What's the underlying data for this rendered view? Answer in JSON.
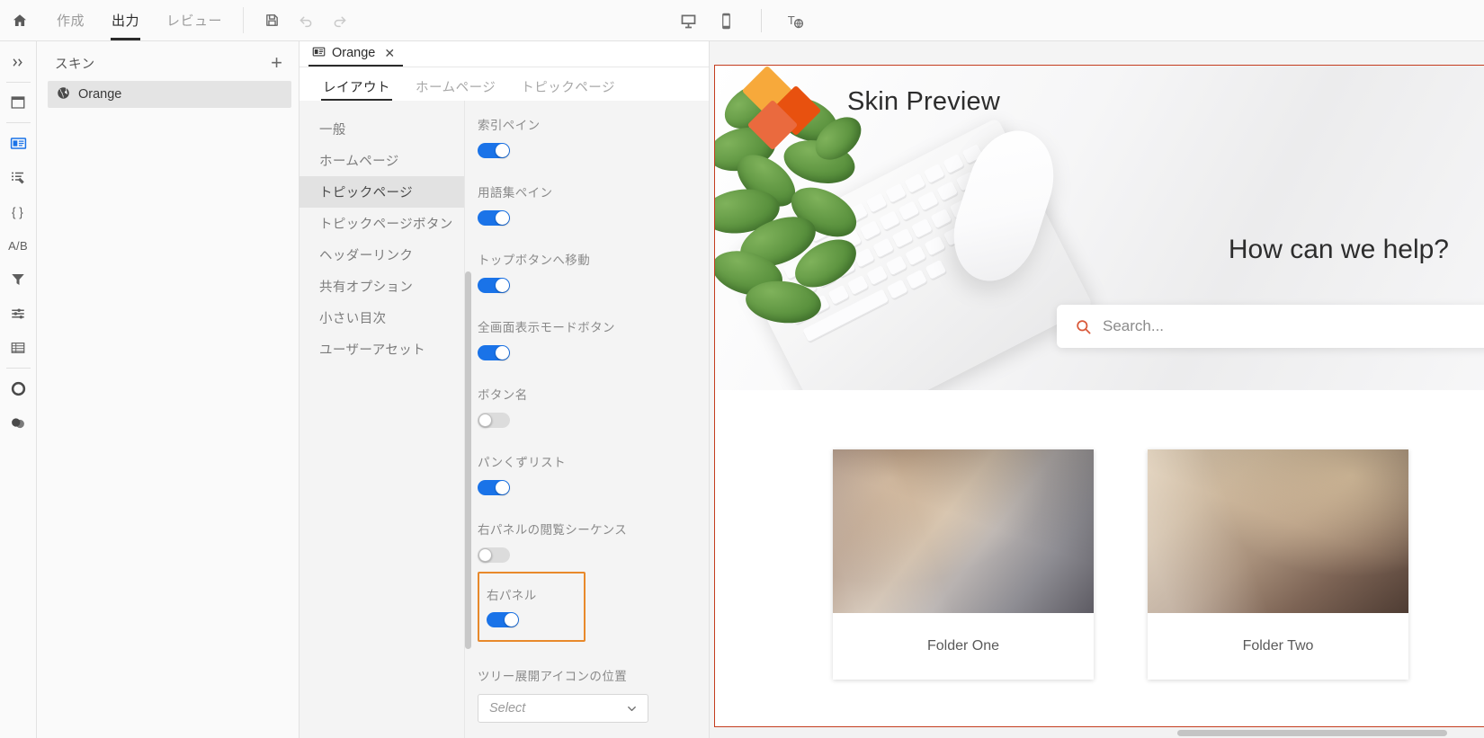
{
  "topbar": {
    "home_icon": "home-icon",
    "menu": [
      {
        "label": "作成",
        "active": false
      },
      {
        "label": "出力",
        "active": true
      },
      {
        "label": "レビュー",
        "active": false
      }
    ],
    "actions": [
      {
        "name": "save-icon",
        "label": "保存"
      },
      {
        "name": "undo-icon",
        "label": "元に戻す"
      },
      {
        "name": "redo-icon",
        "label": "やり直し"
      }
    ],
    "devices": [
      {
        "name": "desktop-preview-icon",
        "label": "デスクトップ"
      },
      {
        "name": "mobile-preview-icon",
        "label": "モバイル"
      }
    ],
    "translate": {
      "name": "translate-icon",
      "label": "翻訳"
    }
  },
  "rail": {
    "items": [
      {
        "name": "expand-rail-icon",
        "label": "展開",
        "active": false
      },
      {
        "name": "window-icon",
        "label": "コンテンツ",
        "active": false
      },
      {
        "name": "skin-icon",
        "label": "スキン",
        "active": true
      },
      {
        "name": "list-tag-icon",
        "label": "タグ",
        "active": false
      },
      {
        "name": "braces-icon",
        "label": "変数",
        "active": false
      },
      {
        "name": "ab-icon",
        "label": "A/B",
        "active": false
      },
      {
        "name": "filter-icon",
        "label": "フィルター",
        "active": false
      },
      {
        "name": "sliders-icon",
        "label": "設定",
        "active": false
      },
      {
        "name": "table-icon",
        "label": "テーブル",
        "active": false
      },
      {
        "name": "circle-icon",
        "label": "ステータス",
        "active": false
      },
      {
        "name": "layers-icon",
        "label": "レイヤー",
        "active": false
      }
    ]
  },
  "skins": {
    "title": "スキン",
    "add_label": "+",
    "items": [
      {
        "label": "Orange",
        "icon": "globe-icon",
        "selected": true
      }
    ]
  },
  "settings": {
    "doc_tab": {
      "label": "Orange",
      "icon": "skin-icon",
      "close_label": "✕"
    },
    "subtabs": [
      {
        "label": "レイアウト",
        "active": true
      },
      {
        "label": "ホームページ",
        "active": false
      },
      {
        "label": "トピックページ",
        "active": false
      }
    ],
    "sections": [
      {
        "label": "一般",
        "active": false
      },
      {
        "label": "ホームページ",
        "active": false
      },
      {
        "label": "トピックページ",
        "active": true
      },
      {
        "label": "トピックページボタン",
        "active": false
      },
      {
        "label": "ヘッダーリンク",
        "active": false
      },
      {
        "label": "共有オプション",
        "active": false
      },
      {
        "label": "小さい目次",
        "active": false
      },
      {
        "label": "ユーザーアセット",
        "active": false
      }
    ],
    "options": [
      {
        "label": "索引ペイン",
        "type": "toggle",
        "value": "on",
        "highlighted": false
      },
      {
        "label": "用語集ペイン",
        "type": "toggle",
        "value": "on",
        "highlighted": false
      },
      {
        "label": "トップボタンへ移動",
        "type": "toggle",
        "value": "on",
        "highlighted": false
      },
      {
        "label": "全画面表示モードボタン",
        "type": "toggle",
        "value": "on",
        "highlighted": false
      },
      {
        "label": "ボタン名",
        "type": "toggle",
        "value": "off",
        "highlighted": false
      },
      {
        "label": "パンくずリスト",
        "type": "toggle",
        "value": "on",
        "highlighted": false
      },
      {
        "label": "右パネルの閲覧シーケンス",
        "type": "toggle",
        "value": "off",
        "highlighted": false
      },
      {
        "label": "右パネル",
        "type": "toggle",
        "value": "on",
        "highlighted": true
      },
      {
        "label": "ツリー展開アイコンの位置",
        "type": "select",
        "value": "Select",
        "highlighted": false
      }
    ],
    "highlight_color": "#e8892b"
  },
  "preview": {
    "title": "Skin Preview",
    "help_heading": "How can we help?",
    "search": {
      "placeholder": "Search...",
      "icon": "search-icon"
    },
    "logo": {
      "name": "orange-diamond-logo",
      "colors": [
        "#f7a93b",
        "#e8510f",
        "#ea6a3e"
      ]
    },
    "cards": [
      {
        "label": "Folder One"
      },
      {
        "label": "Folder Two"
      }
    ],
    "border_color": "#c43c1e"
  }
}
